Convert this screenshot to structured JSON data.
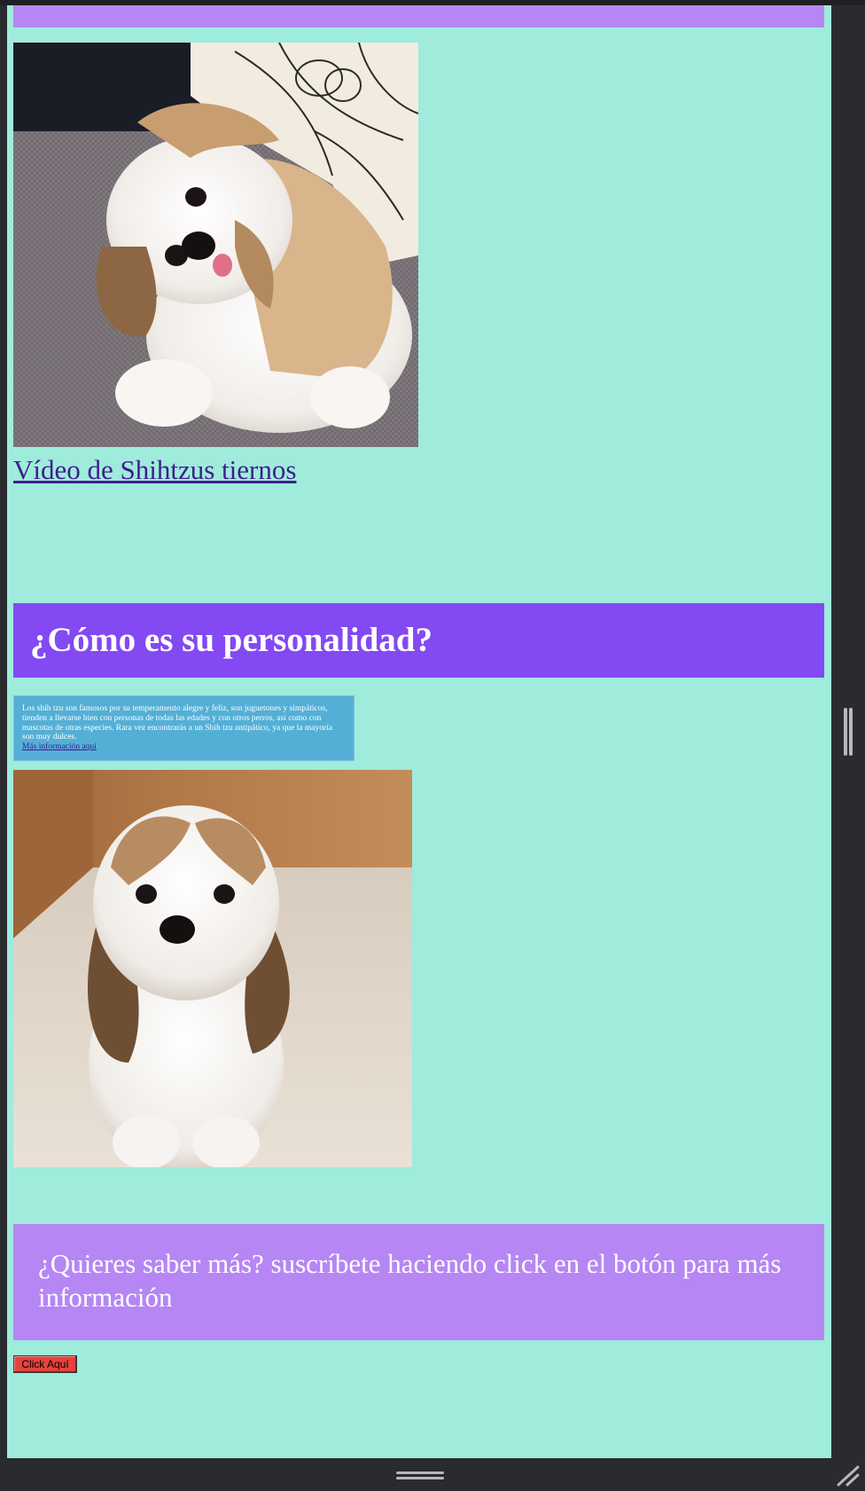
{
  "gallery": {
    "video_link": "Vídeo de Shihtzus tiernos"
  },
  "personality": {
    "heading": "¿Cómo es su personalidad?",
    "text": "Los shih tzu son famosos por su temperamento alegre y feliz, son juguetones y simpáticos, tienden a llevarse bien con personas de todas las edades y con otros perros, así como con mascotas de otras especies. Rara vez encontrarás a un Shih tzu antipático, ya que la mayoría son muy dulces.",
    "more_link": "Más información aquí"
  },
  "subscribe": {
    "text": "¿Quieres saber más? suscríbete haciendo click en el botón para más información",
    "button_label": "Click Aquí"
  },
  "icons": {
    "photo1": "shih-tzu-photo-sofa",
    "photo2": "shih-tzu-photo-floor",
    "vertical_splitter": "drag-handle-icon",
    "horizontal_splitter": "drag-handle-icon",
    "resize": "resize-corner-icon"
  },
  "colors": {
    "page_background": "#9febdc",
    "light_purple_banner": "#b686f5",
    "dark_purple_header": "#8349f3",
    "info_box": "#54afd6",
    "link": "#3d1f8c",
    "button": "#e6423c",
    "chrome": "#2a2b2e"
  }
}
